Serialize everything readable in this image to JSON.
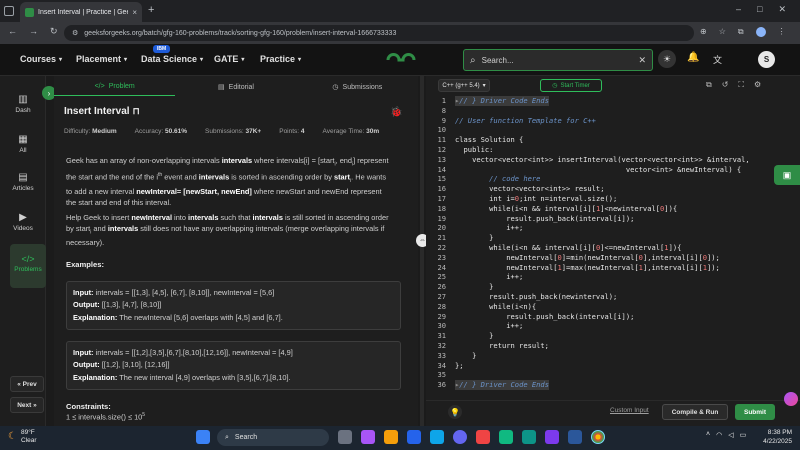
{
  "browser": {
    "tab_title": "Insert Interval | Practice | Geek",
    "url": "geeksforgeeks.org/batch/gfg-160-problems/track/sorting-gfg-160/problem/insert-interval-1666733333"
  },
  "header": {
    "nav": [
      "Courses",
      "Placement",
      "Data Science",
      "GATE",
      "Practice"
    ],
    "ibm_badge": "IBM",
    "search_placeholder": "Search...",
    "avatar_letter": "S"
  },
  "rail": {
    "items": [
      "Dash",
      "All",
      "Articles",
      "Videos",
      "Problems"
    ],
    "prev": "« Prev",
    "next": "Next »"
  },
  "problem": {
    "tabs": [
      "Problem",
      "Editorial",
      "Submissions"
    ],
    "title": "Insert Interval",
    "difficulty_label": "Difficulty:",
    "difficulty": "Medium",
    "accuracy_label": "Accuracy:",
    "accuracy": "50.61%",
    "submissions_label": "Submissions:",
    "submissions": "37K+",
    "points_label": "Points:",
    "points": "4",
    "avg_time_label": "Average Time:",
    "avg_time": "30m",
    "examples_label": "Examples:",
    "constraints_label": "Constraints:",
    "constraint_1": "1 ≤ intervals.size() ≤ 10"
  },
  "examples": [
    {
      "input": "intervals = [[1,3], [4,5], [6,7], [8,10]], newInterval = [5,6]",
      "output": "[[1,3], [4,7], [8,10]]",
      "explanation": "The newInterval [5,6] overlaps with [4,5] and [6,7]."
    },
    {
      "input": "intervals = [[1,2],[3,5],[6,7],[8,10],[12,16]], newInterval = [4,9]",
      "output": "[[1,2], [3,10], [12,16]]",
      "explanation": "The new interval [4,9] overlaps with [3,5],[6,7],[8,10]."
    }
  ],
  "editor": {
    "language": "C++ (g++ 5.4)",
    "timer": "Start Timer",
    "custom_input": "Custom Input",
    "compile_run": "Compile & Run",
    "submit": "Submit"
  },
  "taskbar": {
    "temp": "89°F",
    "weather": "Clear",
    "search": "Search",
    "time": "8:38 PM",
    "date": "4/22/2025"
  }
}
